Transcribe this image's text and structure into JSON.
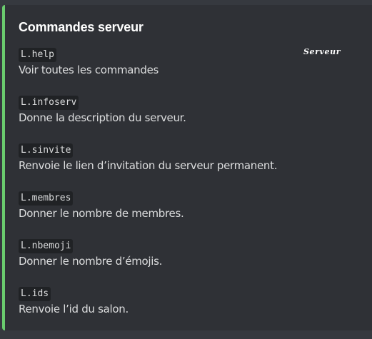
{
  "embed": {
    "accent_color": "#6acb6e",
    "title": "Commandes serveur",
    "thumbnail_text": "Serveur"
  },
  "fields": [
    {
      "command": "L.help",
      "description": "Voir toutes les commandes"
    },
    {
      "command": "L.infoserv",
      "description": "Donne la description du serveur."
    },
    {
      "command": "L.sinvite",
      "description": "Renvoie le lien d’invitation du serveur permanent."
    },
    {
      "command": "L.membres",
      "description": "Donner le nombre de membres."
    },
    {
      "command": "L.nbemoji",
      "description": "Donner le nombre d’émojis."
    },
    {
      "command": "L.ids",
      "description": "Renvoie l’id du salon."
    }
  ]
}
